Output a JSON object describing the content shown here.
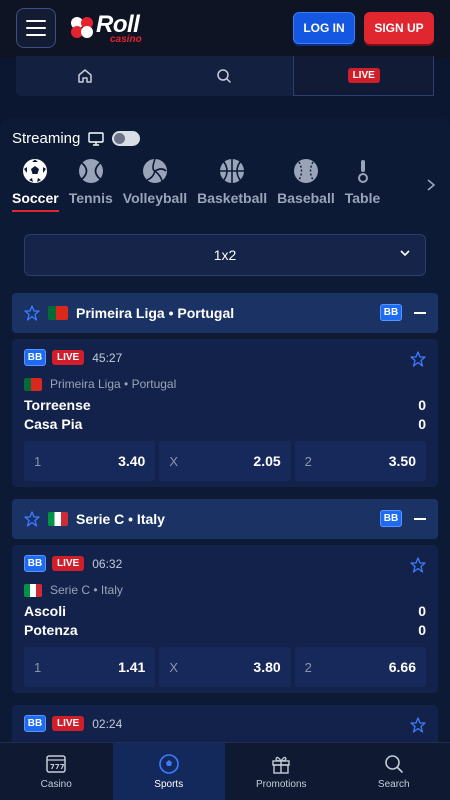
{
  "header": {
    "logo_word": "Roll",
    "logo_sub": "casino",
    "login_label": "LOG IN",
    "signup_label": "SIGN UP"
  },
  "subnav": {
    "live_label": "LIVE"
  },
  "streaming": {
    "label": "Streaming"
  },
  "sports": [
    {
      "label": "Soccer"
    },
    {
      "label": "Tennis"
    },
    {
      "label": "Volleyball"
    },
    {
      "label": "Basketball"
    },
    {
      "label": "Baseball"
    },
    {
      "label": "Table"
    }
  ],
  "market_select": {
    "value": "1x2"
  },
  "leagues": [
    {
      "name": "Primeira Liga • Portugal",
      "badge": "BB",
      "match": {
        "badge": "BB",
        "live": "LIVE",
        "time": "45:27",
        "competition": "Primeira Liga • Portugal",
        "home": "Torreense",
        "away": "Casa Pia",
        "home_score": "0",
        "away_score": "0",
        "odds": [
          {
            "key": "1",
            "value": "3.40"
          },
          {
            "key": "X",
            "value": "2.05"
          },
          {
            "key": "2",
            "value": "3.50"
          }
        ]
      }
    },
    {
      "name": "Serie C • Italy",
      "badge": "BB",
      "match": {
        "badge": "BB",
        "live": "LIVE",
        "time": "06:32",
        "competition": "Serie C • Italy",
        "home": "Ascoli",
        "away": "Potenza",
        "home_score": "0",
        "away_score": "0",
        "odds": [
          {
            "key": "1",
            "value": "1.41"
          },
          {
            "key": "X",
            "value": "3.80"
          },
          {
            "key": "2",
            "value": "6.66"
          }
        ]
      }
    }
  ],
  "partial_match": {
    "badge": "BB",
    "live": "LIVE",
    "time": "02:24"
  },
  "bottom_nav": [
    {
      "label": "Casino"
    },
    {
      "label": "Sports"
    },
    {
      "label": "Promotions"
    },
    {
      "label": "Search"
    }
  ],
  "colors": {
    "accent_blue": "#1457e0",
    "accent_red": "#e0262e",
    "background": "#0b1730"
  }
}
